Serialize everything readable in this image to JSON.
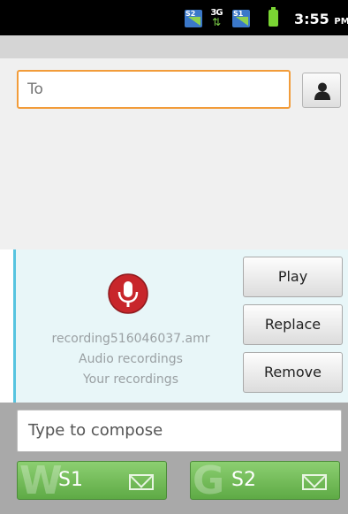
{
  "status_bar": {
    "sim1_label": "S2",
    "network_label": "3G",
    "sim2_label": "S1",
    "time": "3:55",
    "ampm": "PM"
  },
  "recipient": {
    "placeholder": "To"
  },
  "attachment": {
    "file_name": "recording516046037.amr",
    "type_label": "Audio recordings",
    "source_label": "Your recordings",
    "buttons": {
      "play": "Play",
      "replace": "Replace",
      "remove": "Remove"
    }
  },
  "compose": {
    "placeholder": "Type to compose"
  },
  "send_buttons": [
    {
      "letter": "W",
      "label": "S1"
    },
    {
      "letter": "G",
      "label": "S2"
    }
  ],
  "colors": {
    "focus_border": "#f29c3a",
    "attachment_accent": "#56c4e0",
    "send_green": "#6cb552",
    "mic_red": "#c8262b"
  },
  "icons": {
    "contact": "contact-person-icon",
    "mic": "microphone-icon",
    "send": "envelope-icon"
  }
}
